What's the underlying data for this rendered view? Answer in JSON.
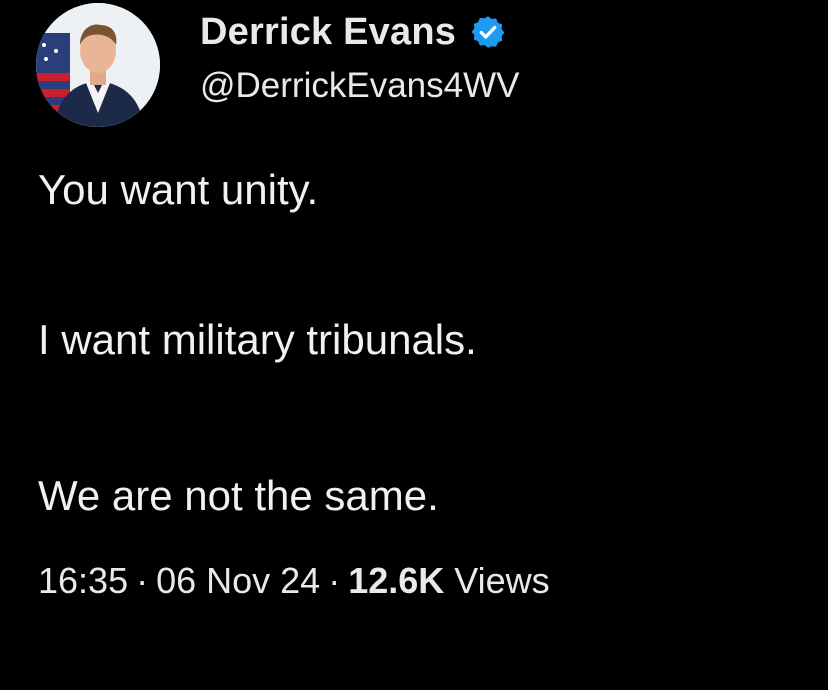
{
  "author": {
    "display_name": "Derrick Evans",
    "handle": "@DerrickEvans4WV",
    "verified": true,
    "avatar_icon": "profile-photo"
  },
  "tweet": {
    "lines": [
      "You want unity.",
      "I want military tribunals.",
      "We are not the same."
    ]
  },
  "meta": {
    "time": "16:35",
    "separator": "·",
    "date": "06 Nov 24",
    "views_count": "12.6K",
    "views_label": "Views"
  },
  "colors": {
    "background": "#000000",
    "text": "#e7e9ea",
    "verified_badge": "#1d9bf0"
  }
}
